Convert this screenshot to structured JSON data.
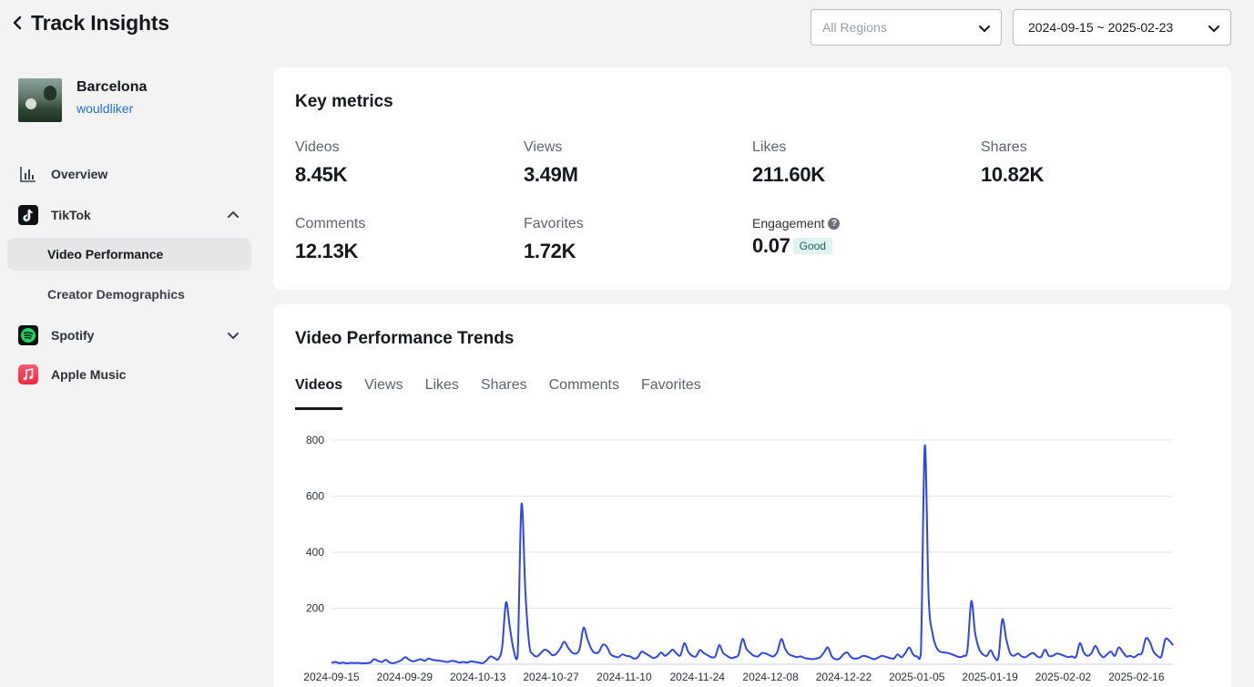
{
  "header": {
    "title": "Track Insights",
    "region_placeholder": "All Regions",
    "date_range": "2024-09-15 ~ 2025-02-23"
  },
  "track": {
    "name": "Barcelona",
    "artist": "wouldliker"
  },
  "sidebar": {
    "overview": "Overview",
    "tiktok": "TikTok",
    "video_performance": "Video Performance",
    "creator_demographics": "Creator Demographics",
    "spotify": "Spotify",
    "apple_music": "Apple Music"
  },
  "metrics": {
    "title": "Key metrics",
    "items": [
      {
        "label": "Videos",
        "value": "8.45K"
      },
      {
        "label": "Views",
        "value": "3.49M"
      },
      {
        "label": "Likes",
        "value": "211.60K"
      },
      {
        "label": "Shares",
        "value": "10.82K"
      },
      {
        "label": "Comments",
        "value": "12.13K"
      },
      {
        "label": "Favorites",
        "value": "1.72K"
      }
    ],
    "engagement": {
      "label": "Engagement",
      "value": "0.07",
      "badge": "Good"
    }
  },
  "trends": {
    "title": "Video Performance Trends",
    "tabs": [
      "Videos",
      "Views",
      "Likes",
      "Shares",
      "Comments",
      "Favorites"
    ],
    "active_tab": "Videos"
  },
  "colors": {
    "line": "#2f45e8",
    "accent_link": "#1e6fd6"
  },
  "chart_data": {
    "type": "line",
    "ylim": [
      0,
      800
    ],
    "yticks": [
      200,
      400,
      600,
      800
    ],
    "xticks": [
      "2024-09-15",
      "2024-09-29",
      "2024-10-13",
      "2024-10-27",
      "2024-11-10",
      "2024-11-24",
      "2024-12-08",
      "2024-12-22",
      "2025-01-05",
      "2025-01-19",
      "2025-02-02",
      "2025-02-16"
    ],
    "x": [
      "2024-09-15",
      "2024-09-16",
      "2024-09-17",
      "2024-09-18",
      "2024-09-19",
      "2024-09-20",
      "2024-09-21",
      "2024-09-22",
      "2024-09-23",
      "2024-09-24",
      "2024-09-25",
      "2024-09-26",
      "2024-09-27",
      "2024-09-28",
      "2024-09-29",
      "2024-09-30",
      "2024-10-01",
      "2024-10-02",
      "2024-10-03",
      "2024-10-04",
      "2024-10-05",
      "2024-10-06",
      "2024-10-07",
      "2024-10-08",
      "2024-10-09",
      "2024-10-10",
      "2024-10-11",
      "2024-10-12",
      "2024-10-13",
      "2024-10-14",
      "2024-10-15",
      "2024-10-16",
      "2024-10-17",
      "2024-10-18",
      "2024-10-19",
      "2024-10-20",
      "2024-10-21",
      "2024-10-22",
      "2024-10-23",
      "2024-10-24",
      "2024-10-25",
      "2024-10-26",
      "2024-10-27",
      "2024-10-28",
      "2024-10-29",
      "2024-10-30",
      "2024-10-31",
      "2024-11-01",
      "2024-11-02",
      "2024-11-03",
      "2024-11-04",
      "2024-11-05",
      "2024-11-06",
      "2024-11-07",
      "2024-11-08",
      "2024-11-09",
      "2024-11-10",
      "2024-11-11",
      "2024-11-12",
      "2024-11-13",
      "2024-11-14",
      "2024-11-15",
      "2024-11-16",
      "2024-11-17",
      "2024-11-18",
      "2024-11-19",
      "2024-11-20",
      "2024-11-21",
      "2024-11-22",
      "2024-11-23",
      "2024-11-24",
      "2024-11-25",
      "2024-11-26",
      "2024-11-27",
      "2024-11-28",
      "2024-11-29",
      "2024-11-30",
      "2024-12-01",
      "2024-12-02",
      "2024-12-03",
      "2024-12-04",
      "2024-12-05",
      "2024-12-06",
      "2024-12-07",
      "2024-12-08",
      "2024-12-09",
      "2024-12-10",
      "2024-12-11",
      "2024-12-12",
      "2024-12-13",
      "2024-12-14",
      "2024-12-15",
      "2024-12-16",
      "2024-12-17",
      "2024-12-18",
      "2024-12-19",
      "2024-12-20",
      "2024-12-21",
      "2024-12-22",
      "2024-12-23",
      "2024-12-24",
      "2024-12-25",
      "2024-12-26",
      "2024-12-27",
      "2024-12-28",
      "2024-12-29",
      "2024-12-30",
      "2024-12-31",
      "2025-01-01",
      "2025-01-02",
      "2025-01-03",
      "2025-01-04",
      "2025-01-05",
      "2025-01-06",
      "2025-01-07",
      "2025-01-08",
      "2025-01-09",
      "2025-01-10",
      "2025-01-11",
      "2025-01-12",
      "2025-01-13",
      "2025-01-14",
      "2025-01-15",
      "2025-01-16",
      "2025-01-17",
      "2025-01-18",
      "2025-01-19",
      "2025-01-20",
      "2025-01-21",
      "2025-01-22",
      "2025-01-23",
      "2025-01-24",
      "2025-01-25",
      "2025-01-26",
      "2025-01-27",
      "2025-01-28",
      "2025-01-29",
      "2025-01-30",
      "2025-01-31",
      "2025-02-01",
      "2025-02-02",
      "2025-02-03",
      "2025-02-04",
      "2025-02-05",
      "2025-02-06",
      "2025-02-07",
      "2025-02-08",
      "2025-02-09",
      "2025-02-10",
      "2025-02-11",
      "2025-02-12",
      "2025-02-13",
      "2025-02-14",
      "2025-02-15",
      "2025-02-16",
      "2025-02-17",
      "2025-02-18",
      "2025-02-19",
      "2025-02-20",
      "2025-02-21",
      "2025-02-22",
      "2025-02-23"
    ],
    "values": [
      5,
      8,
      4,
      6,
      3,
      5,
      4,
      5,
      3,
      4,
      6,
      18,
      12,
      8,
      16,
      6,
      4,
      8,
      14,
      25,
      16,
      10,
      14,
      18,
      12,
      20,
      16,
      14,
      12,
      10,
      8,
      12,
      10,
      6,
      8,
      6,
      10,
      8,
      6,
      4,
      14,
      28,
      22,
      18,
      60,
      220,
      130,
      50,
      30,
      570,
      260,
      70,
      35,
      28,
      40,
      52,
      45,
      32,
      38,
      56,
      80,
      60,
      42,
      38,
      55,
      130,
      90,
      55,
      40,
      45,
      70,
      62,
      35,
      28,
      25,
      35,
      30,
      28,
      20,
      25,
      45,
      38,
      30,
      22,
      28,
      42,
      30,
      40,
      52,
      38,
      32,
      75,
      45,
      30,
      28,
      50,
      40,
      32,
      25,
      28,
      68,
      40,
      30,
      22,
      25,
      35,
      90,
      55,
      40,
      30,
      28,
      40,
      38,
      32,
      28,
      45,
      90,
      55,
      35,
      30,
      25,
      28,
      22,
      20,
      18,
      20,
      25,
      42,
      60,
      28,
      18,
      20,
      35,
      42,
      25,
      20,
      22,
      30,
      28,
      22,
      18,
      24,
      30,
      26,
      22,
      20,
      35,
      25,
      40,
      60,
      35,
      28,
      40,
      780,
      240,
      110,
      60,
      45,
      42,
      40,
      35,
      30,
      25,
      30,
      50,
      225,
      110,
      55,
      35,
      30,
      50,
      25,
      25,
      160,
      90,
      40,
      30,
      38,
      28,
      25,
      35,
      40,
      28,
      26,
      52,
      30,
      30,
      38,
      35,
      30,
      25,
      28,
      26,
      75,
      42,
      30,
      40,
      65,
      40,
      25,
      35,
      45,
      30,
      60,
      45,
      28,
      30,
      25,
      35,
      40,
      92,
      80,
      45,
      30,
      28,
      88,
      85,
      68
    ]
  }
}
